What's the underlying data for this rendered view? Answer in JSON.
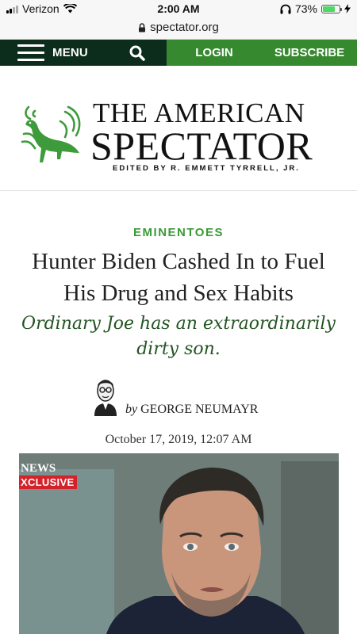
{
  "status_bar": {
    "carrier": "Verizon",
    "time": "2:00 AM",
    "battery": "73%",
    "battery_level": 0.73
  },
  "browser": {
    "url": "spectator.org"
  },
  "site_nav": {
    "menu_label": "MENU",
    "login_label": "LOGIN",
    "subscribe_label": "SUBSCRIBE"
  },
  "masthead": {
    "title_line1": "THE AMERICAN",
    "title_line2": "SPECTATOR",
    "editor": "EDITED BY R. EMMETT TYRRELL, JR."
  },
  "article": {
    "category": "EMINENTOES",
    "headline": "Hunter Biden Cashed In to Fuel His Drug and Sex Habits",
    "subheadline": "Ordinary Joe has an extraordinarily dirty son.",
    "byline_prefix": "by",
    "author": "GEORGE NEUMAYR",
    "date": "October 17, 2019, 12:07 AM"
  },
  "hero_image": {
    "news_bug": "NEWS",
    "exclusive_label": "XCLUSIVE"
  },
  "colors": {
    "nav_dark": "#0c2d1c",
    "nav_green": "#36892f",
    "kicker_green": "#3a9a35",
    "subhead_green": "#235423",
    "logo_green": "#3e9b3b",
    "exclusive_red": "#d3222a"
  },
  "icons": {
    "wifi": "wifi-icon",
    "lock": "lock-icon",
    "headphones": "headphones-icon",
    "charging": "charging-bolt-icon",
    "menu": "hamburger-icon",
    "search": "search-icon",
    "logo": "turkey-logo-icon"
  }
}
